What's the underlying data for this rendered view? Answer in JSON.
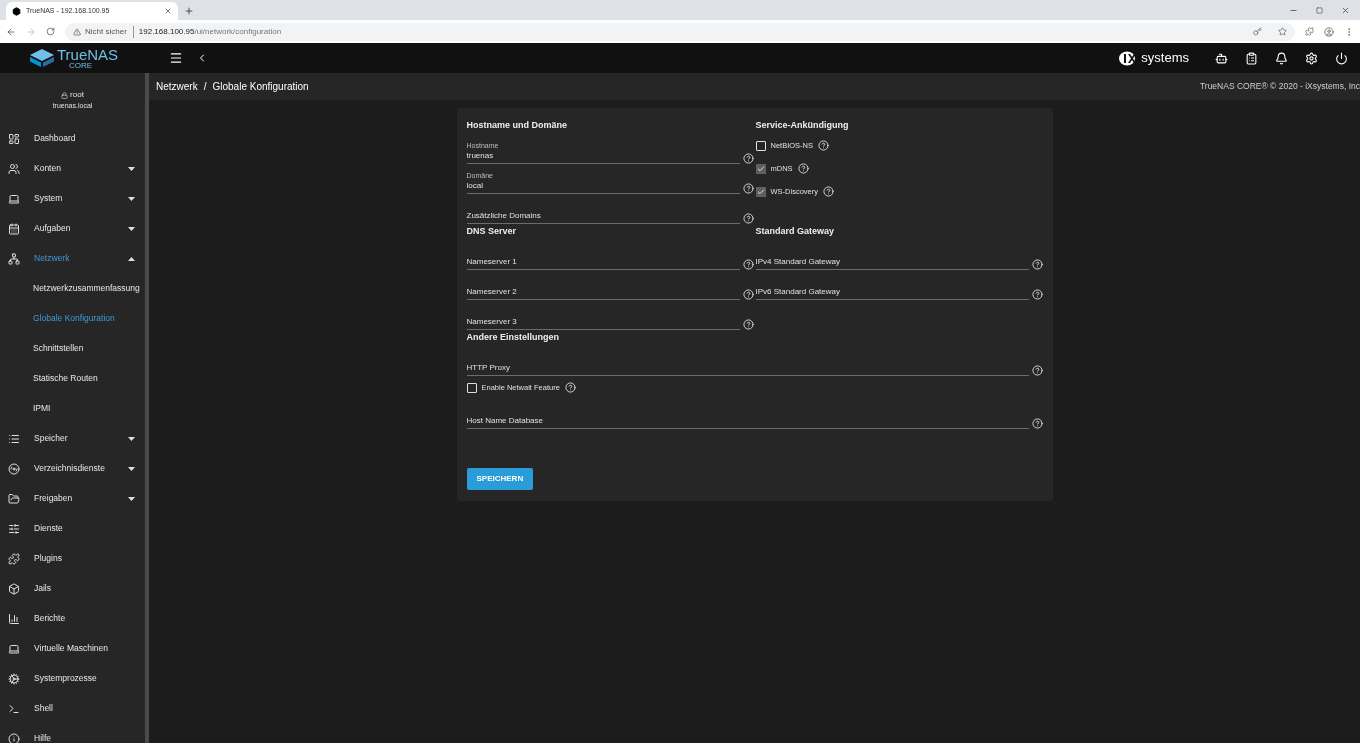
{
  "browser": {
    "tab_title": "TrueNAS - 192.168.100.95",
    "security": "Nicht sicher",
    "url_host": "192.168.100.95",
    "url_path": "/ui/network/configuration"
  },
  "header": {
    "logo": "TrueNAS",
    "logo_sub": "CORE",
    "vendor": "systems"
  },
  "user": {
    "name": "root",
    "host": "truenas.local"
  },
  "sidebar": {
    "items": [
      {
        "label": "Dashboard",
        "selected": false
      },
      {
        "label": "Konten",
        "selected": false,
        "expanded": false
      },
      {
        "label": "System",
        "selected": false,
        "expanded": false
      },
      {
        "label": "Aufgaben",
        "selected": false,
        "expanded": false
      },
      {
        "label": "Netzwerk",
        "selected": true,
        "expanded": true,
        "children": [
          {
            "label": "Netzwerkzusammenfassung",
            "selected": false
          },
          {
            "label": "Globale Konfiguration",
            "selected": true
          },
          {
            "label": "Schnittstellen",
            "selected": false
          },
          {
            "label": "Statische Routen",
            "selected": false
          },
          {
            "label": "IPMI",
            "selected": false
          }
        ]
      },
      {
        "label": "Speicher",
        "selected": false,
        "expanded": false
      },
      {
        "label": "Verzeichnisdienste",
        "selected": false,
        "expanded": false
      },
      {
        "label": "Freigaben",
        "selected": false,
        "expanded": false
      },
      {
        "label": "Dienste",
        "selected": false
      },
      {
        "label": "Plugins",
        "selected": false
      },
      {
        "label": "Jails",
        "selected": false
      },
      {
        "label": "Berichte",
        "selected": false
      },
      {
        "label": "Virtuelle Maschinen",
        "selected": false
      },
      {
        "label": "Systemprozesse",
        "selected": false
      },
      {
        "label": "Shell",
        "selected": false
      },
      {
        "label": "Hilfe",
        "selected": false
      }
    ]
  },
  "breadcrumb": [
    "Netzwerk",
    "Globale Konfiguration"
  ],
  "breadcrumb_separator": "/",
  "copyright": "TrueNAS CORE® © 2020 - iXsystems, Inc",
  "form": {
    "rows": [
      {
        "sections": [
          {
            "title": "Hostname und Domäne",
            "fields": [
              {
                "kind": "input",
                "label": "Hostname",
                "value": "truenas"
              },
              {
                "kind": "input",
                "label": "Domäne",
                "value": "local"
              },
              {
                "kind": "input",
                "label": "Zusätzliche Domains"
              }
            ]
          },
          {
            "title": "Service-Ankündigung",
            "fields": [
              {
                "kind": "checkbox",
                "label": "NetBIOS-NS",
                "checked": false
              },
              {
                "kind": "checkbox",
                "label": "mDNS",
                "checked": true
              },
              {
                "kind": "checkbox",
                "label": "WS-Discovery",
                "checked": true
              }
            ]
          }
        ]
      },
      {
        "sections": [
          {
            "title": "DNS Server",
            "fields": [
              {
                "kind": "input",
                "label": "Nameserver 1"
              },
              {
                "kind": "input",
                "label": "Nameserver 2"
              },
              {
                "kind": "input",
                "label": "Nameserver 3"
              }
            ]
          },
          {
            "title": "Standard Gateway",
            "fields": [
              {
                "kind": "input",
                "label": "IPv4 Standard Gateway"
              },
              {
                "kind": "input",
                "label": "IPv6 Standard Gateway"
              }
            ]
          }
        ]
      },
      {
        "sections": [
          {
            "title": "Andere Einstellungen",
            "fields": [
              {
                "kind": "input",
                "label": "HTTP Proxy"
              },
              {
                "kind": "checkbox",
                "label": "Enable Netwait Feature",
                "checked": false
              },
              {
                "kind": "input",
                "label": "Host Name Database"
              }
            ]
          }
        ]
      }
    ],
    "save_button": "SPEICHERN"
  }
}
